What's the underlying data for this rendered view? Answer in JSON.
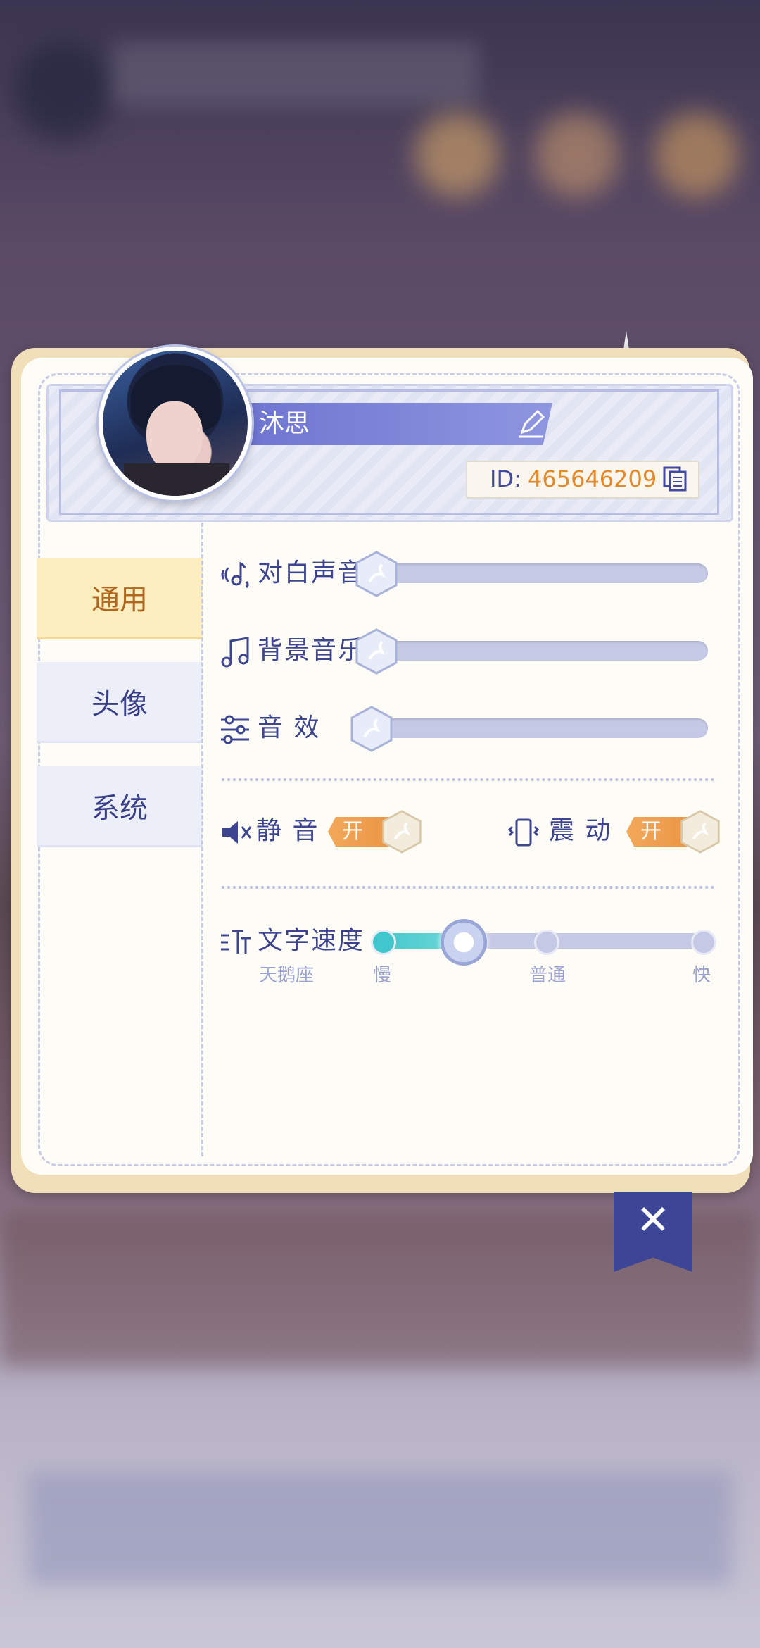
{
  "profile": {
    "name": "沐思",
    "id_label": "ID:",
    "id_value": "465646209"
  },
  "tabs": [
    {
      "label": "通用",
      "active": true
    },
    {
      "label": "头像",
      "active": false
    },
    {
      "label": "系统",
      "active": false
    }
  ],
  "settings": {
    "dialogue_voice_label": "对白声音",
    "dialogue_voice_level": 0,
    "bgm_label": "背景音乐",
    "bgm_level": 0,
    "sfx_label": "音 效",
    "sfx_level": 0,
    "mute_label": "静 音",
    "mute_toggle": "开",
    "vibrate_label": "震 动",
    "vibrate_toggle": "开",
    "text_speed_label": "文字速度",
    "text_speed_sub": "天鹅座",
    "speed_slow": "慢",
    "speed_normal": "普通",
    "speed_fast": "快"
  },
  "colors": {
    "accent": "#3d4490",
    "toggle_orange": "#e99240",
    "id_orange": "#e58a2a",
    "tab_active_bg": "#fdeec0"
  },
  "icons": [
    "edit-icon",
    "copy-icon",
    "dialogue-voice-icon",
    "music-note-icon",
    "equalizer-icon",
    "speaker-mute-icon",
    "vibrate-icon",
    "text-speed-icon",
    "swan-hex-knob",
    "close-icon"
  ]
}
